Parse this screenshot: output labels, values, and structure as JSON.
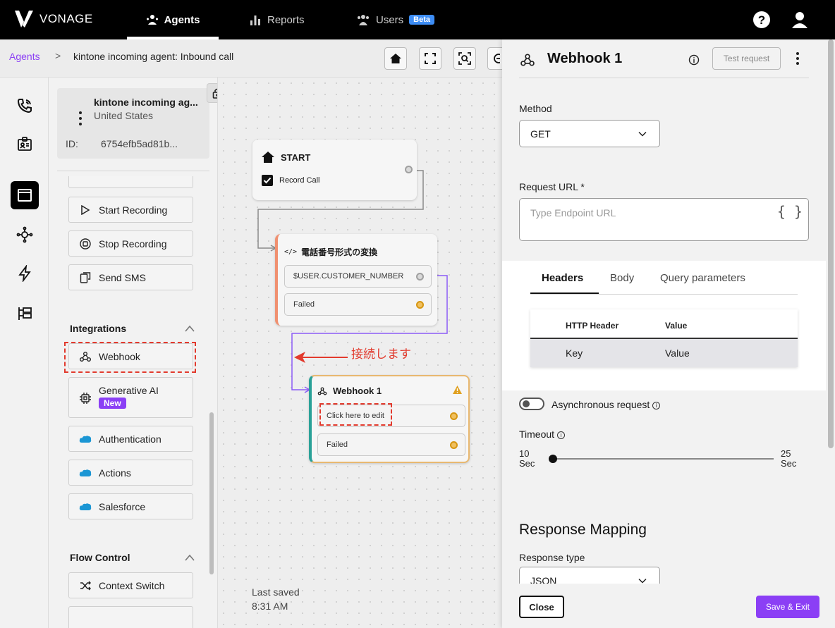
{
  "topbar": {
    "brand": "VONAGE",
    "nav": [
      {
        "label": "Agents",
        "icon": "agents-icon",
        "active": true
      },
      {
        "label": "Reports",
        "icon": "bar-chart-icon",
        "active": false
      },
      {
        "label": "Users",
        "icon": "users-icon",
        "active": false,
        "badge": "Beta"
      }
    ]
  },
  "breadcrumb": {
    "root": "Agents",
    "separator": ">",
    "current": "kintone incoming agent: Inbound call"
  },
  "palette": {
    "agent_name": "kintone incoming ag...",
    "agent_country": "United States",
    "agent_id_label": "ID:",
    "agent_id": "6754efb5ad81b...",
    "items_top": [
      "Start Recording",
      "Stop Recording",
      "Send SMS"
    ],
    "integrations_title": "Integrations",
    "integrations": [
      "Webhook",
      "Generative AI",
      "Authentication",
      "Actions",
      "Salesforce"
    ],
    "new_badge": "New",
    "flow_control_title": "Flow Control",
    "flow_control": [
      "Context Switch"
    ]
  },
  "canvas": {
    "start_node": {
      "title": "START",
      "checkbox_label": "Record Call"
    },
    "convert_node": {
      "title": "電話番号形式の変換",
      "row1": "$USER.CUSTOMER_NUMBER",
      "row2": "Failed"
    },
    "webhook_node": {
      "title": "Webhook 1",
      "row1": "Click here to edit",
      "row2": "Failed"
    },
    "annotation": "接続します",
    "last_saved_label": "Last saved",
    "last_saved_time": "8:31 AM"
  },
  "panel": {
    "title": "Webhook 1",
    "test_request": "Test request",
    "method_label": "Method",
    "method_value": "GET",
    "url_label": "Request URL *",
    "url_placeholder": "Type Endpoint URL",
    "url_brace": "{ }",
    "tabs": [
      "Headers",
      "Body",
      "Query parameters"
    ],
    "table": {
      "col1": "HTTP Header",
      "col2": "Value",
      "row_key": "Key",
      "row_value": "Value"
    },
    "async_label": "Asynchronous request",
    "timeout_label": "Timeout",
    "timeout_min": "10",
    "timeout_max": "25",
    "timeout_unit": "Sec",
    "response_mapping_title": "Response Mapping",
    "response_type_label": "Response type",
    "response_type_value": "JSON",
    "close": "Close",
    "save_exit": "Save & Exit"
  },
  "colors": {
    "accent": "#8b3ff5",
    "annotation_red": "#e23a2d",
    "beta_blue": "#3d8df5"
  }
}
